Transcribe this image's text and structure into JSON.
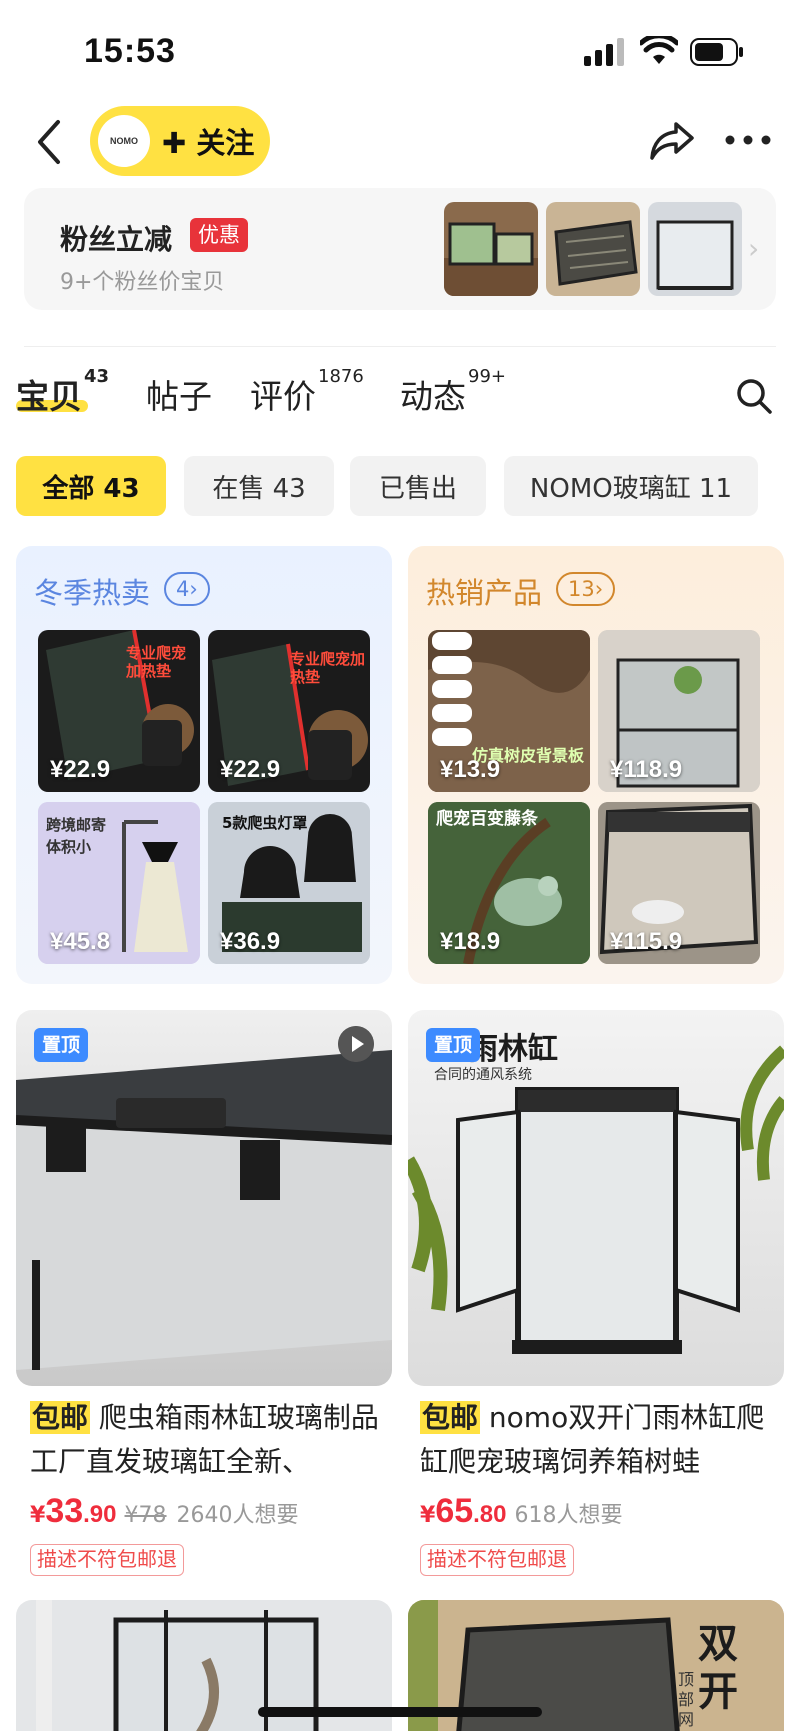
{
  "status_bar": {
    "time": "15:53"
  },
  "header": {
    "logo_text": "NOMO",
    "follow_label": "✚ 关注"
  },
  "fans_card": {
    "title": "粉丝立减",
    "badge": "优惠",
    "subtitle": "9+个粉丝价宝贝",
    "arrow": "›"
  },
  "tabs": [
    {
      "label": "宝贝",
      "count": "43"
    },
    {
      "label": "帖子",
      "count": ""
    },
    {
      "label": "评价",
      "count": "1876"
    },
    {
      "label": "动态",
      "count": "99+"
    }
  ],
  "filters": [
    {
      "label": "全部 43"
    },
    {
      "label": "在售 43"
    },
    {
      "label": "已售出"
    },
    {
      "label": "NOMO玻璃缸 11"
    }
  ],
  "promo_left": {
    "title": "冬季热卖",
    "count": "4",
    "arrow": "›",
    "items": [
      {
        "price": "¥22.9",
        "label": "专业爬宠加热垫"
      },
      {
        "price": "¥22.9",
        "label": "专业爬宠加热垫"
      },
      {
        "price": "¥45.8",
        "label": "跨境邮寄 体积小"
      },
      {
        "price": "¥36.9",
        "label": "5款爬虫灯罩"
      }
    ]
  },
  "promo_right": {
    "title": "热销产品",
    "count": "13",
    "arrow": "›",
    "items": [
      {
        "price": "¥13.9",
        "label": "仿真树皮背景板"
      },
      {
        "price": "¥118.9",
        "label": ""
      },
      {
        "price": "¥18.9",
        "label": "爬宠百变藤条"
      },
      {
        "price": "¥115.9",
        "label": ""
      }
    ]
  },
  "products": [
    {
      "pin": "置顶",
      "tag": "包邮",
      "title": "爬虫箱雨林缸玻璃制品工厂直发玻璃缸全新、",
      "currency": "¥",
      "price_int": "33",
      "price_dec": ".90",
      "orig_price": "¥78",
      "wants": "2640人想要",
      "guarantee": "描述不符包邮退"
    },
    {
      "pin": "置顶",
      "tag": "包邮",
      "overlay_title": "雨林缸",
      "overlay_sub": "合同的通风系统",
      "title": "nomo双开门雨林缸爬缸爬宠玻璃饲养箱树蛙",
      "currency": "¥",
      "price_int": "65",
      "price_dec": ".80",
      "orig_price": "",
      "wants": "618人想要",
      "guarantee": "描述不符包邮退"
    }
  ],
  "row2_right_text": "双开",
  "row2_right_side": "顶部网",
  "colors": {
    "accent_yellow": "#ffe142",
    "price_red": "#ef2d3c",
    "pin_blue": "#3d8bff"
  }
}
